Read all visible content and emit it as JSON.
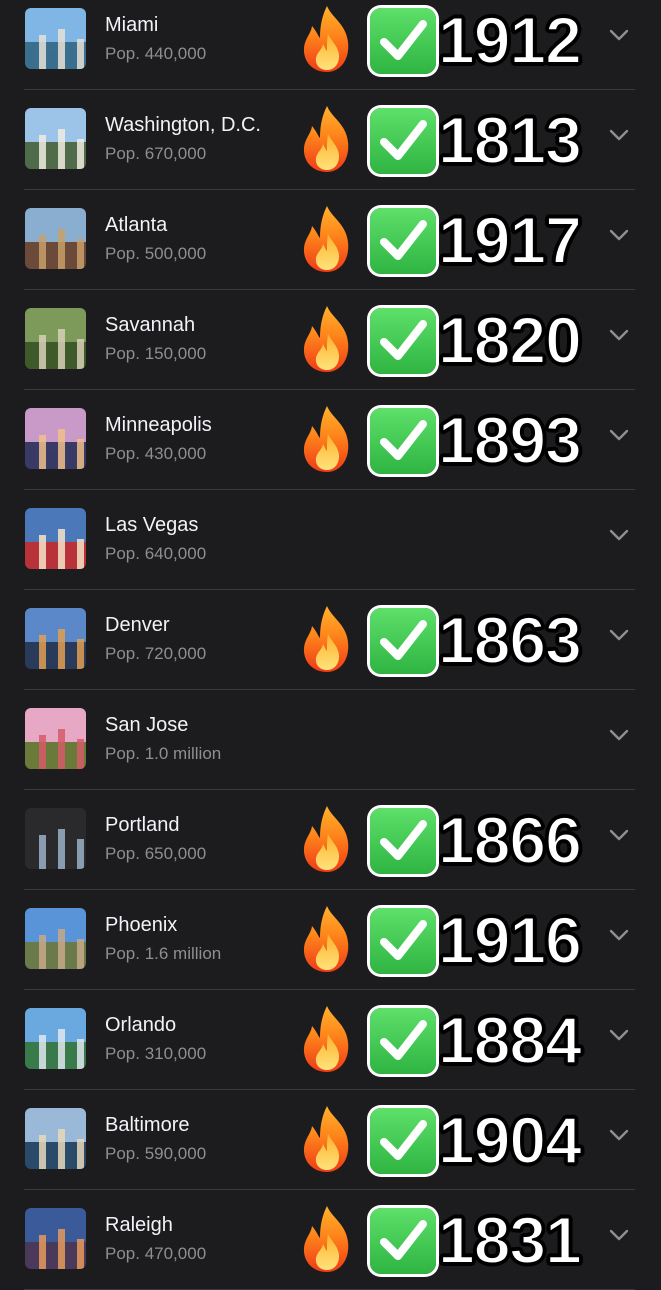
{
  "cities": [
    {
      "name": "Miami",
      "pop": "Pop. 440,000",
      "year": "1912",
      "fire": true,
      "check": true,
      "thumb": {
        "sky": "#7fb6e6",
        "ground": "#3b6f8e",
        "accent": "#e8e1d6"
      }
    },
    {
      "name": "Washington, D.C.",
      "pop": "Pop. 670,000",
      "year": "1813",
      "fire": true,
      "check": true,
      "thumb": {
        "sky": "#9cc3e8",
        "ground": "#4f6b4a",
        "accent": "#f0ece2"
      }
    },
    {
      "name": "Atlanta",
      "pop": "Pop. 500,000",
      "year": "1917",
      "fire": true,
      "check": true,
      "thumb": {
        "sky": "#8aaed0",
        "ground": "#6b4a3a",
        "accent": "#c9a06b"
      }
    },
    {
      "name": "Savannah",
      "pop": "Pop. 150,000",
      "year": "1820",
      "fire": true,
      "check": true,
      "thumb": {
        "sky": "#7e9a5a",
        "ground": "#3f5a2a",
        "accent": "#d8d0b8"
      }
    },
    {
      "name": "Minneapolis",
      "pop": "Pop. 430,000",
      "year": "1893",
      "fire": true,
      "check": true,
      "thumb": {
        "sky": "#c99ac8",
        "ground": "#3a3a66",
        "accent": "#f0c08a"
      }
    },
    {
      "name": "Las Vegas",
      "pop": "Pop. 640,000",
      "year": "",
      "fire": false,
      "check": false,
      "thumb": {
        "sky": "#4a78b8",
        "ground": "#b8323a",
        "accent": "#f4e4c8"
      }
    },
    {
      "name": "Denver",
      "pop": "Pop. 720,000",
      "year": "1863",
      "fire": true,
      "check": true,
      "thumb": {
        "sky": "#5a88c8",
        "ground": "#2a3b5a",
        "accent": "#e0a050"
      }
    },
    {
      "name": "San Jose",
      "pop": "Pop. 1.0 million",
      "year": "",
      "fire": false,
      "check": false,
      "thumb": {
        "sky": "#e6a8c4",
        "ground": "#6a7a3a",
        "accent": "#d65a6a"
      }
    },
    {
      "name": "Portland",
      "pop": "Pop. 650,000",
      "year": "1866",
      "fire": true,
      "check": true,
      "thumb": {
        "sky": "#2a2a2c",
        "ground": "#2a2a2c",
        "accent": "#9ab0c8"
      }
    },
    {
      "name": "Phoenix",
      "pop": "Pop. 1.6 million",
      "year": "1916",
      "fire": true,
      "check": true,
      "thumb": {
        "sky": "#5a94d8",
        "ground": "#6a7a4a",
        "accent": "#c8a888"
      }
    },
    {
      "name": "Orlando",
      "pop": "Pop. 310,000",
      "year": "1884",
      "fire": true,
      "check": true,
      "thumb": {
        "sky": "#6aa8e0",
        "ground": "#3a7a4a",
        "accent": "#e0e8f0"
      }
    },
    {
      "name": "Baltimore",
      "pop": "Pop. 590,000",
      "year": "1904",
      "fire": true,
      "check": true,
      "thumb": {
        "sky": "#9ab8d8",
        "ground": "#2a4a6a",
        "accent": "#e8d8b8"
      }
    },
    {
      "name": "Raleigh",
      "pop": "Pop. 470,000",
      "year": "1831",
      "fire": true,
      "check": true,
      "thumb": {
        "sky": "#3a5a9a",
        "ground": "#4a3a5a",
        "accent": "#e89a5a"
      }
    }
  ],
  "icons": {
    "fire": "fire-icon",
    "check": "check-mark-button-icon",
    "chevron": "chevron-down-icon"
  },
  "colors": {
    "background": "#1c1c1e",
    "divider": "#3a3a3c",
    "name": "#f2f2f7",
    "pop": "#8e8e93",
    "check": "#2fb442",
    "chevron": "#8e8e93"
  }
}
